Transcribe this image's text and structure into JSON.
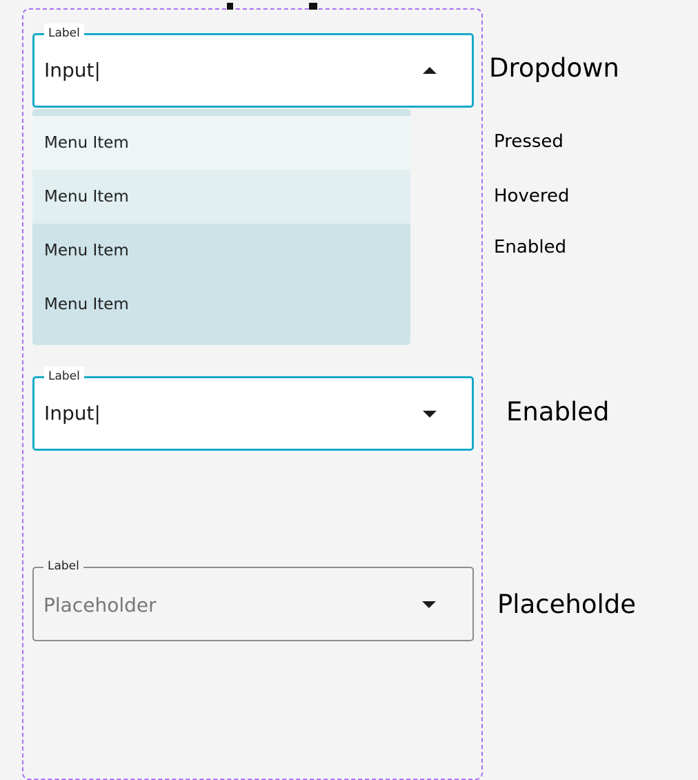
{
  "dropdown_open": {
    "label": "Label",
    "value": "Input|",
    "state_label": "Dropdown"
  },
  "menu": {
    "items": [
      {
        "label": "Menu Item",
        "state": "Pressed",
        "background": "#edf5f6"
      },
      {
        "label": "Menu Item",
        "state": "Hovered",
        "background": "#e1eff1"
      },
      {
        "label": "Menu Item",
        "state": "Enabled",
        "background": "#cde3e8"
      },
      {
        "label": "Menu Item",
        "state": "",
        "background": "#cde3e8"
      }
    ]
  },
  "dropdown_enabled": {
    "label": "Label",
    "value": "Input|",
    "state_label": "Enabled"
  },
  "dropdown_placeholder": {
    "label": "Label",
    "placeholder": "Placeholder",
    "state_label": "Placeholde"
  },
  "colors": {
    "accent_border": "#17aac9",
    "frame_dashed": "#a970f5",
    "placeholder_border": "#8d8d8d",
    "menu_background": "#cde3e8"
  }
}
